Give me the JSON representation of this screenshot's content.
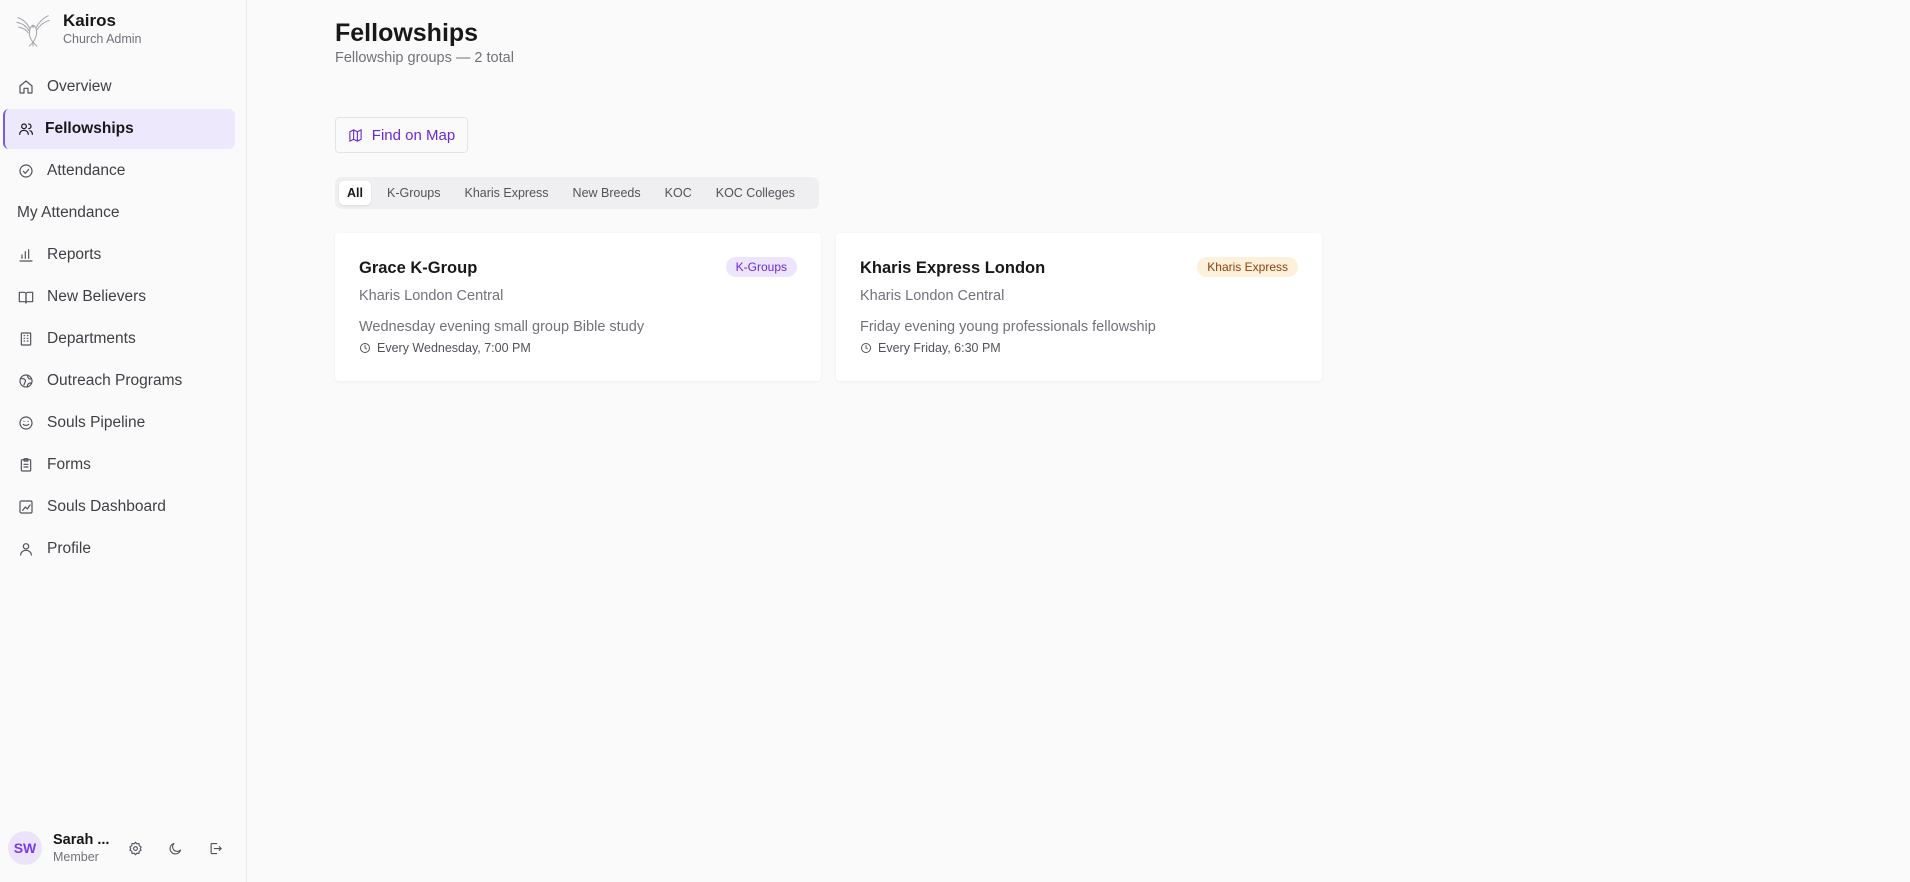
{
  "brand": {
    "title": "Kairos",
    "subtitle": "Church Admin"
  },
  "sidebar": {
    "items": [
      {
        "label": "Overview",
        "icon": "home-icon"
      },
      {
        "label": "Fellowships",
        "icon": "users-icon",
        "active": true
      },
      {
        "label": "Attendance",
        "icon": "check-circle-icon"
      },
      {
        "label": "My Attendance",
        "icon": ""
      },
      {
        "label": "Reports",
        "icon": "bar-chart-icon"
      },
      {
        "label": "New Believers",
        "icon": "book-open-icon"
      },
      {
        "label": "Departments",
        "icon": "building-icon"
      },
      {
        "label": "Outreach Programs",
        "icon": "globe-icon"
      },
      {
        "label": "Souls Pipeline",
        "icon": "smile-icon"
      },
      {
        "label": "Forms",
        "icon": "clipboard-icon"
      },
      {
        "label": "Souls Dashboard",
        "icon": "dashboard-icon"
      },
      {
        "label": "Profile",
        "icon": "user-icon"
      }
    ]
  },
  "user": {
    "initials": "SW",
    "name": "Sarah ...",
    "role": "Member"
  },
  "page": {
    "title": "Fellowships",
    "subtitle": "Fellowship groups — 2 total",
    "map_button": "Find on Map"
  },
  "tabs": [
    {
      "label": "All",
      "active": true
    },
    {
      "label": "K-Groups"
    },
    {
      "label": "Kharis Express"
    },
    {
      "label": "New Breeds"
    },
    {
      "label": "KOC"
    },
    {
      "label": "KOC Colleges"
    }
  ],
  "cards": [
    {
      "title": "Grace K-Group",
      "badge": "K-Groups",
      "badge_color": "#ede5fd",
      "location": "Kharis London Central",
      "description": "Wednesday evening small group Bible study",
      "schedule": "Every Wednesday, 7:00 PM"
    },
    {
      "title": "Kharis Express London",
      "badge": "Kharis Express",
      "badge_color": "#fdf1dc",
      "location": "Kharis London Central",
      "description": "Friday evening young professionals fellowship",
      "schedule": "Every Friday, 6:30 PM"
    }
  ],
  "colors": {
    "accent": "#7c3aed",
    "active_nav_bg": "#ede8fb"
  }
}
